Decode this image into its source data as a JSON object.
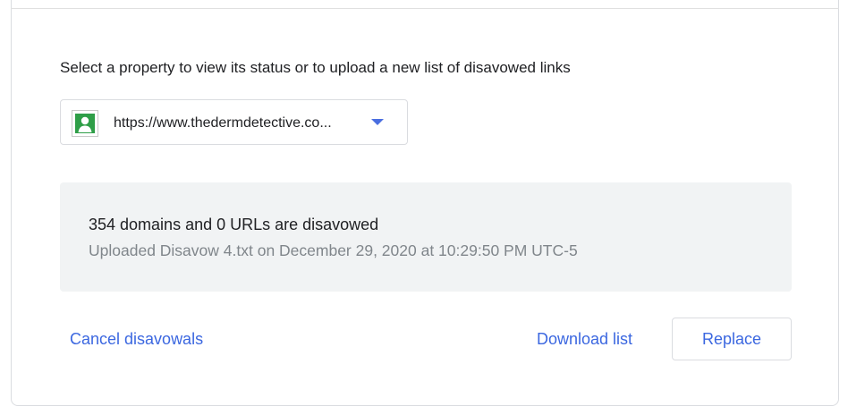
{
  "instructions": {
    "prompt": "Select a property to view its status or to upload a new list of disavowed links"
  },
  "property_selector": {
    "selected_value": "https://www.thedermdetective.co...",
    "icon": "property-person-icon",
    "caret_icon": "chevron-down-icon"
  },
  "status": {
    "summary": "354 domains and 0 URLs are disavowed",
    "upload_detail": "Uploaded Disavow 4.txt on December 29, 2020 at 10:29:50 PM UTC-5"
  },
  "actions": {
    "cancel_label": "Cancel disavowals",
    "download_label": "Download list",
    "replace_label": "Replace"
  },
  "colors": {
    "accent": "#3b67e0",
    "panel_bg": "#f1f3f4",
    "icon_green": "#2e9e47"
  }
}
